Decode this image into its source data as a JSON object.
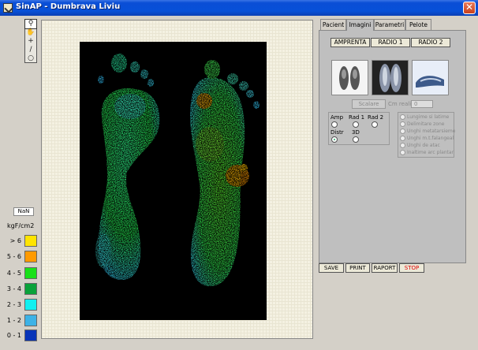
{
  "window": {
    "title": "SinAP - Dumbrava Liviu",
    "close_glyph": "✕"
  },
  "toolbox": {
    "tools": [
      {
        "name": "zoom-icon",
        "glyph": "⚲"
      },
      {
        "name": "hand-icon",
        "glyph": "✋"
      },
      {
        "name": "crosshair-icon",
        "glyph": "+"
      },
      {
        "name": "line-icon",
        "glyph": "/"
      },
      {
        "name": "circle-icon",
        "glyph": "○"
      }
    ]
  },
  "readout": {
    "value": "NaN"
  },
  "legend": {
    "unit": "kgF/cm2",
    "items": [
      {
        "label": "> 6",
        "color": "#ffe400"
      },
      {
        "label": "5 - 6",
        "color": "#ff9a00"
      },
      {
        "label": "4 - 5",
        "color": "#18e018"
      },
      {
        "label": "3 - 4",
        "color": "#0aa23a"
      },
      {
        "label": "2 - 3",
        "color": "#10f0f0"
      },
      {
        "label": "1 - 2",
        "color": "#3db2e6"
      },
      {
        "label": "0 - 1",
        "color": "#0834b8"
      }
    ]
  },
  "tabs": [
    {
      "label": "Pacient",
      "active": false
    },
    {
      "label": "Imagini",
      "active": true
    },
    {
      "label": "Parametri",
      "active": false
    },
    {
      "label": "Pelote",
      "active": false
    }
  ],
  "imagini": {
    "buttons": [
      "AMPRENTA",
      "RADIO 1",
      "RADIO 2"
    ],
    "scalare": "Scalare",
    "cm_reali_label": "Cm reali",
    "cm_reali_value": "0",
    "view_options": [
      {
        "label": "Amp",
        "checked": false
      },
      {
        "label": "Rad 1",
        "checked": false
      },
      {
        "label": "Rad 2",
        "checked": false
      },
      {
        "label": "Distr",
        "checked": true
      },
      {
        "label": "3D",
        "checked": false
      }
    ],
    "measurements": [
      "Lungime si latime",
      "Delimitare zone",
      "Unghi metatarsieme",
      "Unghi m.t.falangeal",
      "Unghi de atac",
      "Inaltime arc plantar"
    ]
  },
  "actions": [
    "SAVE",
    "PRINT",
    "RAPORT",
    "STOP"
  ]
}
